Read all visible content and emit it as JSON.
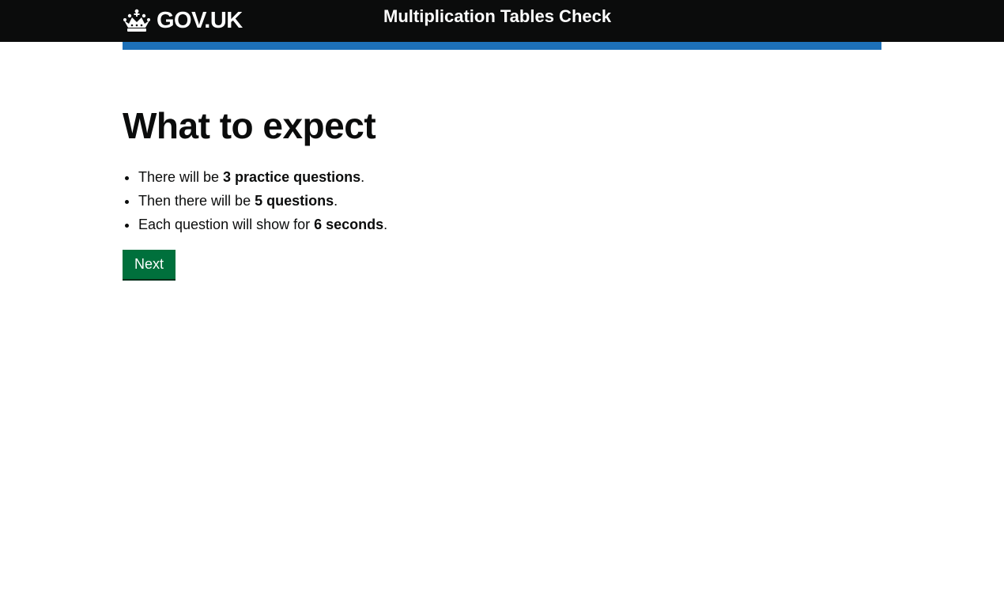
{
  "header": {
    "logo_text": "GOV.UK",
    "logo_icon": "crown-icon",
    "service_name": "Multiplication Tables Check"
  },
  "main": {
    "heading": "What to expect",
    "items": [
      {
        "before": "There will be ",
        "bold": "3 practice questions",
        "after": "."
      },
      {
        "before": "Then there will be ",
        "bold": "5 questions",
        "after": "."
      },
      {
        "before": "Each question will show for ",
        "bold": "6 seconds",
        "after": "."
      }
    ],
    "next_label": "Next"
  },
  "colors": {
    "header_bg": "#0b0c0c",
    "accent_bar": "#1d70b8",
    "button_bg": "#00703c",
    "button_shadow": "#002d18"
  }
}
